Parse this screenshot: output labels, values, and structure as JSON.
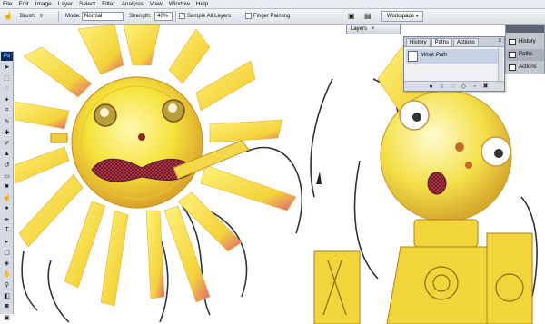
{
  "menu": [
    "File",
    "Edit",
    "Image",
    "Layer",
    "Select",
    "Filter",
    "Analysis",
    "View",
    "Window",
    "Help"
  ],
  "options": {
    "brush_label": "Brush:",
    "brush_size": "9",
    "mode_label": "Mode:",
    "mode_value": "Normal",
    "strength_label": "Strength:",
    "strength_value": "40%",
    "sample_all_layers": "Sample All Layers",
    "finger_painting": "Finger Painting",
    "workspace": "Workspace"
  },
  "tools_panel": {
    "logo": "Ps"
  },
  "layers_tab": {
    "label": "Layers"
  },
  "paths_panel": {
    "tabs": [
      "History",
      "Paths",
      "Actions"
    ],
    "active_tab": "Paths",
    "rows": [
      "Work Path"
    ]
  },
  "dock": {
    "items": [
      "History",
      "Paths",
      "Actions"
    ],
    "selected": "Paths"
  },
  "colors": {
    "sun_yellow": "#f6e23a",
    "sun_orange": "#e8a33a",
    "ray_pink": "#e0607a",
    "ui_gray": "#d6dae2"
  }
}
